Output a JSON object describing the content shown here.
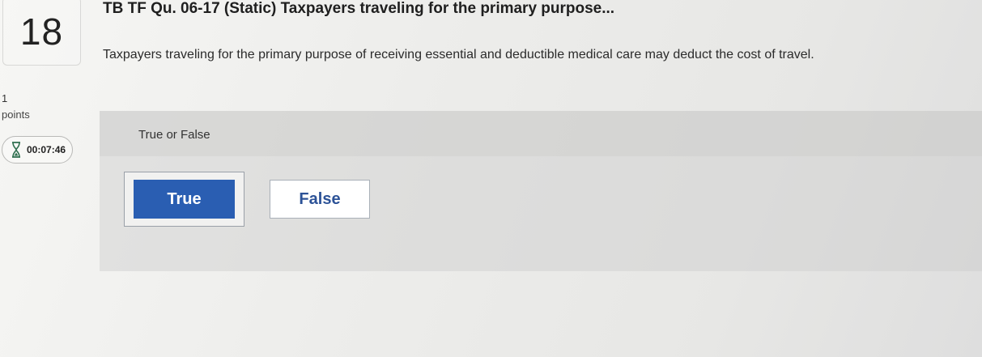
{
  "question": {
    "number": "18",
    "title": "TB TF Qu. 06-17 (Static) Taxpayers traveling for the primary purpose...",
    "text": "Taxpayers traveling for the primary purpose of receiving essential and deductible medical care may deduct the cost of travel."
  },
  "points": {
    "value": "1",
    "label": "points"
  },
  "timer": {
    "icon": "hourglass-icon",
    "value": "00:07:46"
  },
  "answer": {
    "type_label": "True or False",
    "options": [
      {
        "label": "True",
        "selected": true
      },
      {
        "label": "False",
        "selected": false
      }
    ]
  },
  "colors": {
    "selected_button": "#2a5eb2",
    "unselected_text": "#2c5297"
  }
}
